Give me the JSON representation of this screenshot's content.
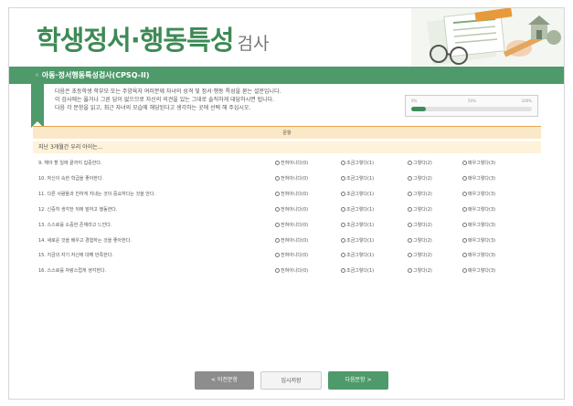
{
  "header": {
    "title_main": "학생정서·행동특성",
    "title_sub": "검사"
  },
  "subtitle": "◦ 아동·정서행동특성검사(CPSQ-II)",
  "intro": {
    "lines": [
      "다음은 초등학생 학부모 또는 주양육자 여러분께 자녀의 성격 및 정서·행동 특성을 묻는 설문입니다.",
      "이 검사에는 옳거나 그른 답이 없으므로 자신의 의견을 있는 그대로 솔직하게 대답하시면 됩니다.",
      "다음 각 문항을 읽고, 최근 자녀의 모습에 해당된다고 생각하는 곳에 선택 해 주십시오."
    ]
  },
  "progress": {
    "labels": [
      "0%",
      "50%",
      "100%"
    ],
    "value": 0.12
  },
  "table": {
    "header": "문항",
    "section": "지난 3개월간 우리 아이는...",
    "options": [
      "전혀아니다(0)",
      "조금그렇다(1)",
      "그렇다(2)",
      "매우그렇다(3)"
    ],
    "questions": [
      "9. 해야 할 일에 끝까지 집중한다.",
      "10. 자신이 속한 학급을 좋아한다.",
      "11. 다른 사람들과 친하게 지내는 것이 중요하다는 것을 안다.",
      "12. 신중히 생각한 뒤에 말하고 행동한다.",
      "13. 스스로를 소중한 존재라고 느낀다.",
      "14. 새로운 것을 배우고 경험하는 것을 좋아한다.",
      "15. 지금의 자기 자신에 대해 만족한다.",
      "16. 스스로를 자랑스럽게 생각한다."
    ]
  },
  "buttons": {
    "prev": "< 이전문항",
    "save": "임시저장",
    "next": "다음문항 >"
  },
  "colors": {
    "brand_green": "#4e9a6a",
    "header_orange": "#fbe8c6"
  }
}
